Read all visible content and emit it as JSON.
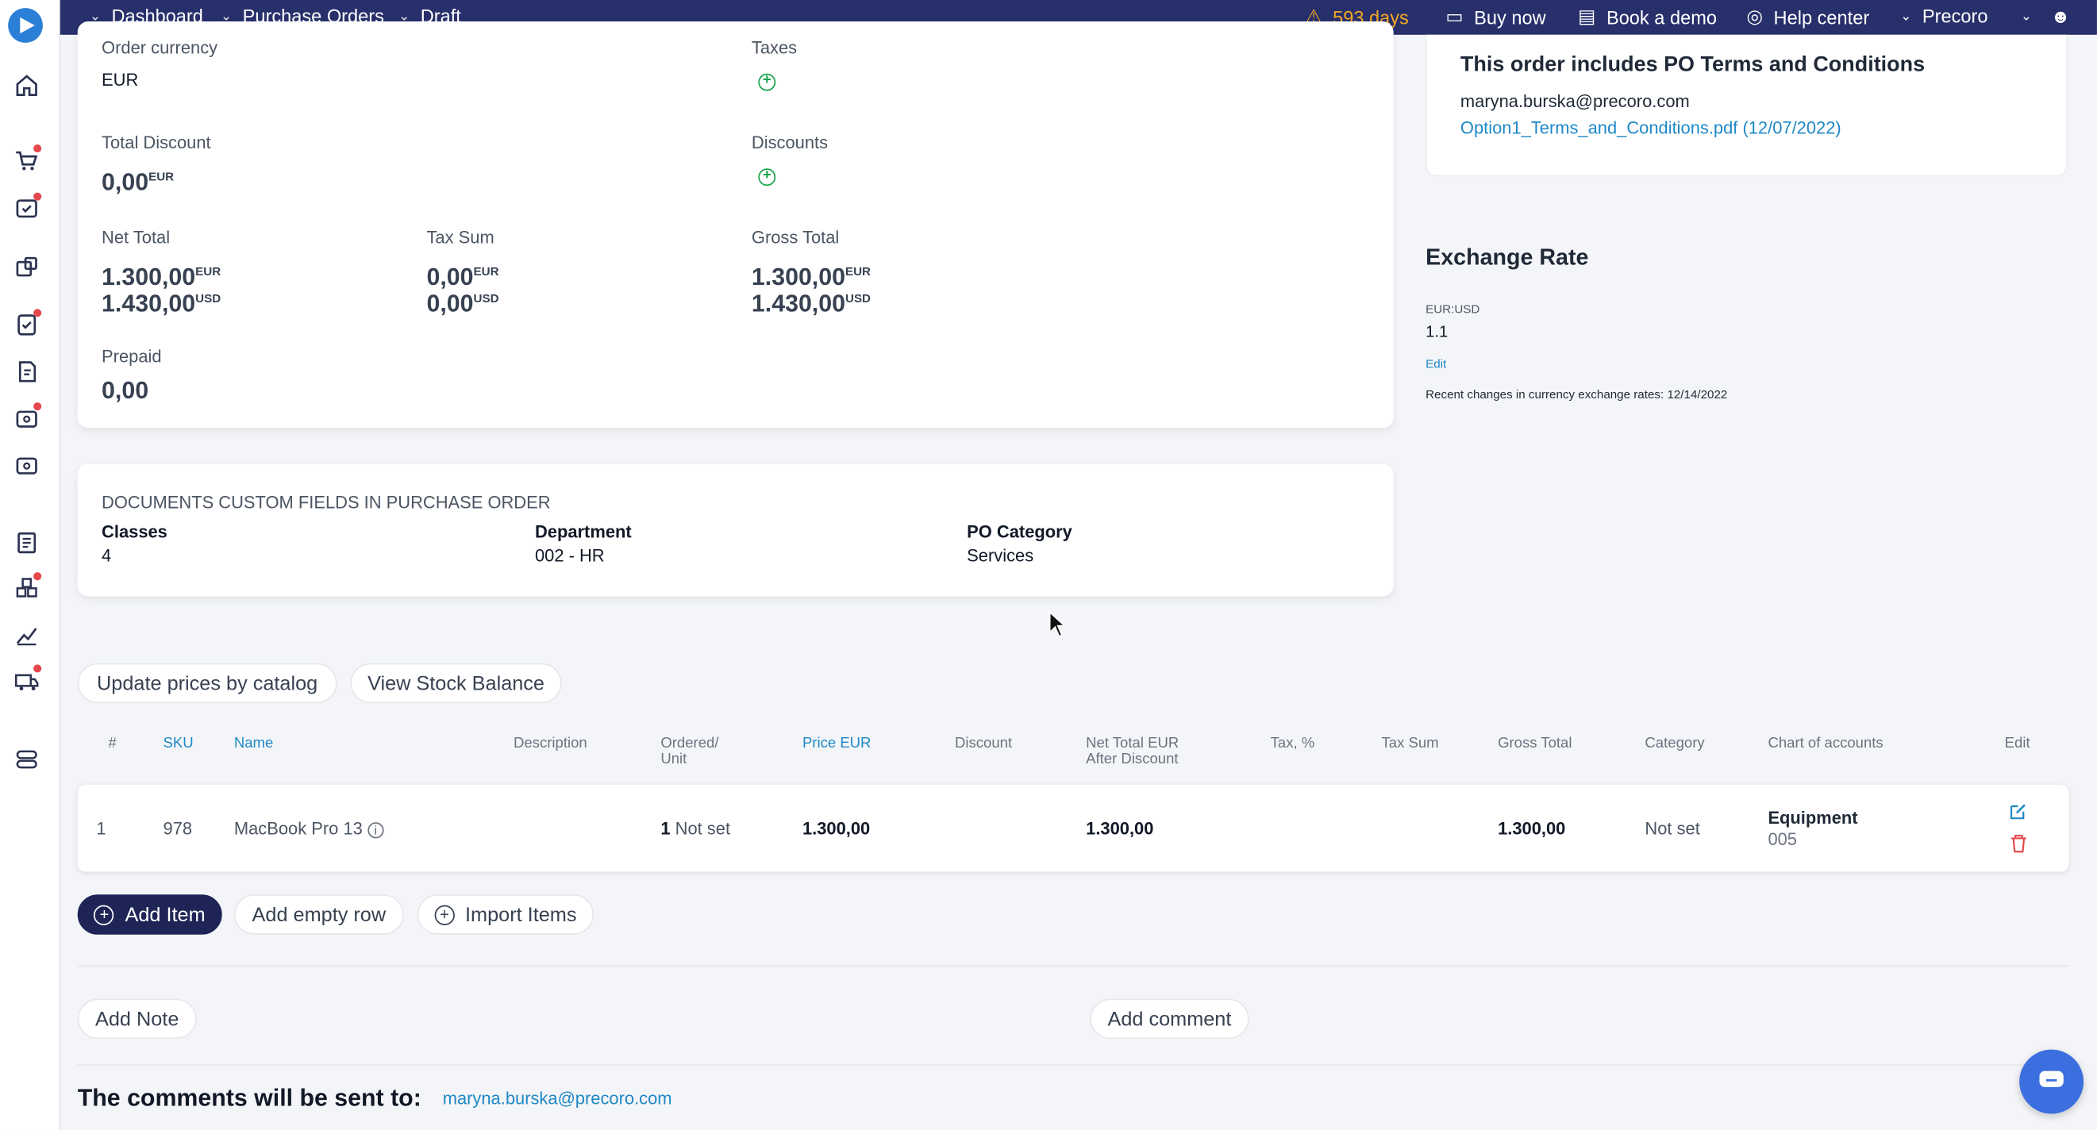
{
  "topbar": {
    "crumbs": [
      "Dashboard",
      "Purchase Orders",
      "Draft"
    ],
    "trial_days": "593 days",
    "buy_now": "Buy now",
    "book_demo": "Book a demo",
    "help_center": "Help center",
    "company": "Precoro"
  },
  "summary": {
    "order_currency_label": "Order currency",
    "order_currency": "EUR",
    "taxes_label": "Taxes",
    "total_discount_label": "Total Discount",
    "total_discount": "0,00",
    "total_discount_cur": "EUR",
    "discounts_label": "Discounts",
    "net_total_label": "Net Total",
    "net_total_eur": "1.300,00",
    "net_total_usd": "1.430,00",
    "tax_sum_label": "Tax Sum",
    "tax_sum_eur": "0,00",
    "tax_sum_usd": "0,00",
    "gross_total_label": "Gross Total",
    "gross_total_eur": "1.300,00",
    "gross_total_usd": "1.430,00",
    "cur_eur": "EUR",
    "cur_usd": "USD",
    "prepaid_label": "Prepaid",
    "prepaid": "0,00"
  },
  "terms": {
    "title": "This order includes PO Terms and Conditions",
    "email": "maryna.burska@precoro.com",
    "file": "Option1_Terms_and_Conditions.pdf (12/07/2022)"
  },
  "exchange": {
    "title": "Exchange Rate",
    "pair": "EUR:USD",
    "rate": "1.1",
    "edit": "Edit",
    "recent_label": "Recent changes in currency exchange rates:",
    "recent_date": "12/14/2022"
  },
  "custom_fields": {
    "heading": "DOCUMENTS CUSTOM FIELDS IN PURCHASE ORDER",
    "classes_label": "Classes",
    "classes": "4",
    "department_label": "Department",
    "department": "002 - HR",
    "category_label": "PO Category",
    "category": "Services"
  },
  "actions": {
    "update_prices": "Update prices by catalog",
    "stock_balance": "View Stock Balance",
    "add_item": "Add Item",
    "add_empty_row": "Add empty row",
    "import_items": "Import Items",
    "add_note": "Add Note",
    "add_comment": "Add comment"
  },
  "table": {
    "headers": {
      "num": "#",
      "sku": "SKU",
      "name": "Name",
      "description": "Description",
      "ordered_1": "Ordered/",
      "ordered_2": "Unit",
      "price": "Price EUR",
      "discount": "Discount",
      "net_1": "Net Total EUR",
      "net_2": "After Discount",
      "tax": "Tax, %",
      "tax_sum": "Tax Sum",
      "gross": "Gross Total",
      "category": "Category",
      "chart": "Chart of accounts",
      "edit": "Edit"
    },
    "row": {
      "num": "1",
      "sku": "978",
      "name": "MacBook Pro 13",
      "qty": "1",
      "unit": "Not set",
      "price": "1.300,00",
      "net": "1.300,00",
      "gross": "1.300,00",
      "category": "Not set",
      "chart_name": "Equipment",
      "chart_code": "005"
    }
  },
  "comments": {
    "label": "The comments will be sent to:",
    "email": "maryna.burska@precoro.com"
  }
}
